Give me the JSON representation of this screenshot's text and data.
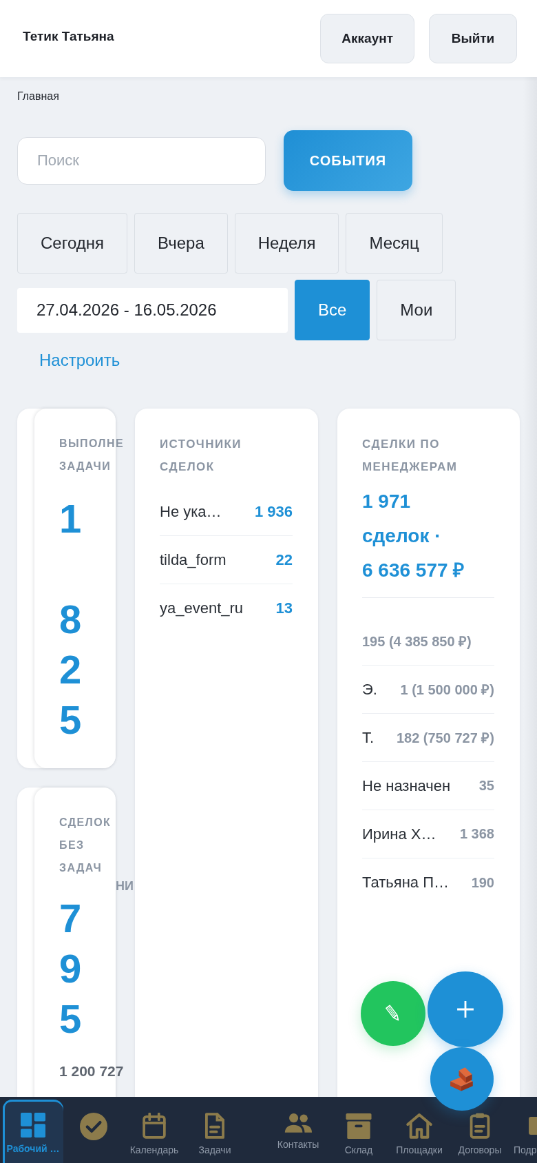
{
  "header": {
    "user_name": "Тетик Татьяна",
    "buttons": [
      {
        "label": "Аккаунт"
      },
      {
        "label": "Выйти"
      }
    ]
  },
  "breadcrumb": "Главная",
  "search": {
    "placeholder": "Поиск"
  },
  "events_button": "СОБЫТИЯ",
  "period_tabs": [
    {
      "label": "Сегодня",
      "selected": false
    },
    {
      "label": "Вчера",
      "selected": false
    },
    {
      "label": "Неделя",
      "selected": false
    },
    {
      "label": "Месяц",
      "selected": false
    }
  ],
  "date_range": {
    "value": "27.04.2026 - 16.05.2026"
  },
  "scope_tabs": [
    {
      "label": "Все",
      "selected": true
    },
    {
      "label": "Мои",
      "selected": false
    }
  ],
  "settings_link": "Настроить",
  "widgets": [
    {
      "kind": "metric",
      "title": "ВЫПОЛНЕ ЗАДАЧИ",
      "value": "1 825"
    },
    {
      "kind": "sources",
      "title": "ИСТОЧНИКИ СДЕЛОК",
      "rows": [
        {
          "name": "Не ука…",
          "count": "1 936"
        },
        {
          "name": "tilda_form",
          "count": "22"
        },
        {
          "name": "ya_event_ru",
          "count": "13"
        }
      ]
    },
    {
      "kind": "managers",
      "title": "СДЕЛКИ ПО МЕНЕДЖЕРАМ",
      "summary": "1 971 сделок · 6 636 577 ₽",
      "rows": [
        {
          "count": "195 (4 385 850 ₽)"
        },
        {
          "name": "Э.",
          "count": "1 (1 500 000 ₽)"
        },
        {
          "name": "Т.",
          "count": "182 (750 727 ₽)"
        },
        {
          "name": "Не назначен",
          "count": "35"
        },
        {
          "name": "Ирина Х…",
          "count": "1 368"
        },
        {
          "name": "Татьяна П…",
          "count": "190"
        }
      ]
    },
    {
      "kind": "metric",
      "title": "СДЕЛОК БЕЗ ЗАДАЧ",
      "text_fragment": "НИ",
      "value": "795",
      "amount": "1 200 727"
    }
  ],
  "bottom_nav": [
    {
      "label": "Рабочий …",
      "selected": true
    },
    {
      "selected": false
    },
    {
      "label": "Календарь",
      "selected": false
    },
    {
      "label": "Задачи",
      "selected": false
    },
    {
      "label": "Контакты",
      "selected": false
    },
    {
      "label": "Склад",
      "selected": false
    },
    {
      "label": "Площадки",
      "selected": false
    },
    {
      "label": "Договоры",
      "selected": false
    },
    {
      "label": "Подр",
      "selected": false
    }
  ]
}
